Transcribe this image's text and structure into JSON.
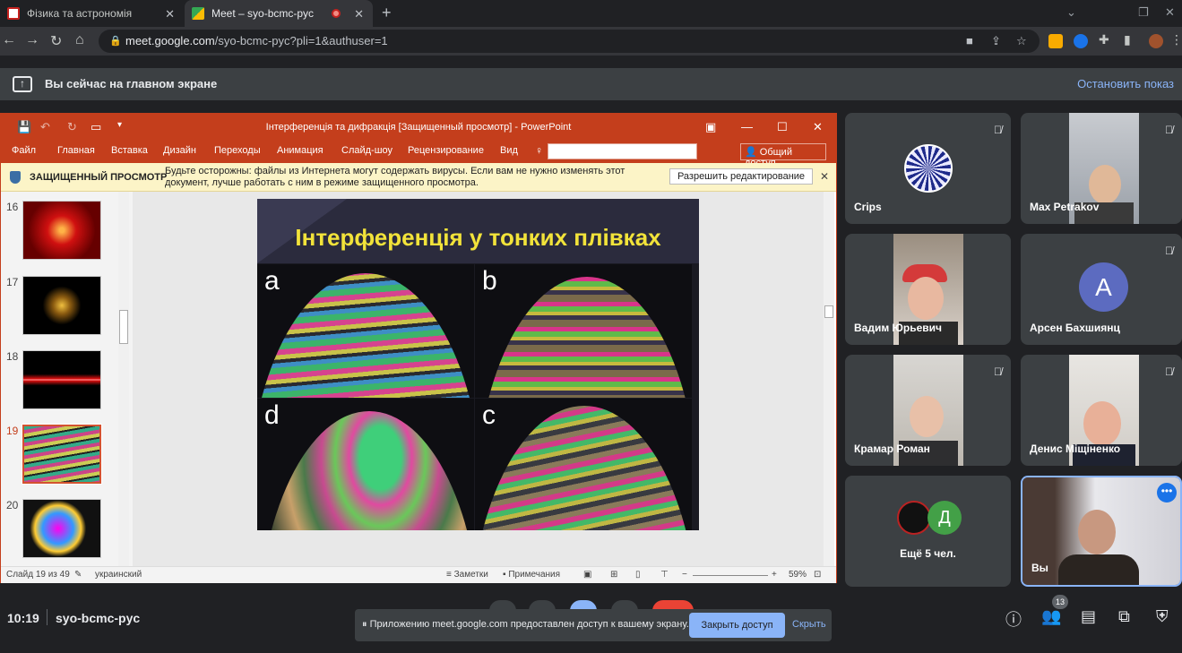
{
  "browser": {
    "tabs": [
      {
        "title": "Фізика та астрономія"
      },
      {
        "title": "Meet – syo-bcmc-pyc"
      }
    ],
    "url_host": "meet.google.com",
    "url_path": "/syo-bcmc-pyc?pli=1&authuser=1"
  },
  "banner": {
    "text": "Вы сейчас на главном экране",
    "stop_label": "Остановить показ"
  },
  "ppt": {
    "title": "Інтерференція та дифракція [Защищенный просмотр] - PowerPoint",
    "menu": [
      "Файл",
      "Главная",
      "Вставка",
      "Дизайн",
      "Переходы",
      "Анимация",
      "Слайд-шоу",
      "Рецензирование",
      "Вид"
    ],
    "share_label": "Общий доступ",
    "protected_label": "ЗАЩИЩЕННЫЙ ПРОСМОТР",
    "protected_msg": "Будьте осторожны: файлы из Интернета могут содержать вирусы. Если вам не нужно изменять этот документ, лучше работать с ним в режиме защищенного просмотра.",
    "enable_editing": "Разрешить редактирование",
    "thumb_numbers": [
      "16",
      "17",
      "18",
      "19",
      "20"
    ],
    "selected_slide": "19",
    "slide_title": "Інтерференція у тонких плівках",
    "panel_labels": [
      "a",
      "b",
      "d",
      "c"
    ],
    "status": {
      "slide_info": "Слайд 19 из 49",
      "language": "украинский",
      "notes": "Заметки",
      "comments": "Примечания",
      "zoom": "59%"
    }
  },
  "participants": [
    {
      "name": "Crips"
    },
    {
      "name": "Max Petrakov"
    },
    {
      "name": "Вадим Юрьевич"
    },
    {
      "name": "Арсен Бахшиянц",
      "initial": "А"
    },
    {
      "name": "Крамар Роман"
    },
    {
      "name": "Денис Міщіненко"
    },
    {
      "name": "Ещё 5 чел.",
      "initial": "Д"
    },
    {
      "name": "Вы"
    }
  ],
  "bottom": {
    "time": "10:19",
    "meeting_code": "syo-bcmc-pyc",
    "share_notice": "Приложению meet.google.com предоставлен доступ к вашему экрану.",
    "close_access": "Закрыть доступ",
    "hide": "Скрыть",
    "people_count": "13"
  },
  "colors": {
    "ppt_accent": "#c43e1c",
    "meet_link": "#8ab4f8",
    "slide_title": "#f2e33a"
  }
}
